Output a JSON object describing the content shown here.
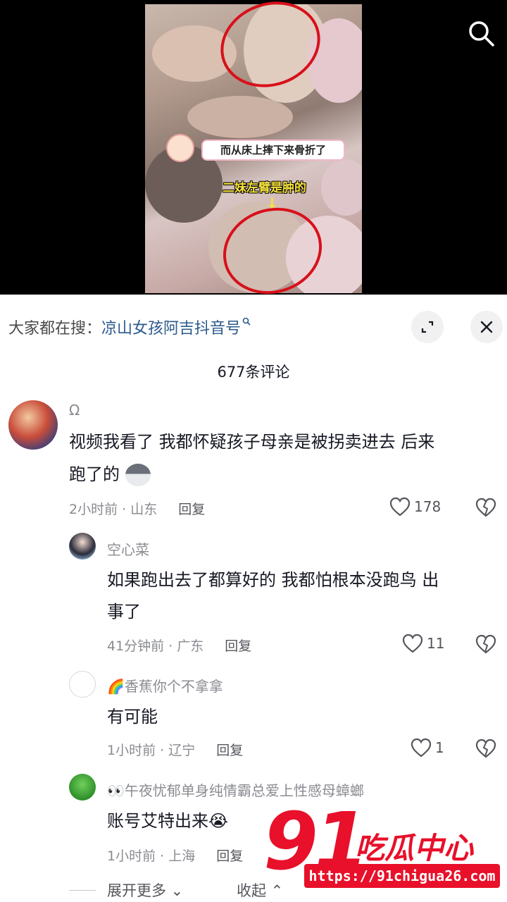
{
  "video": {
    "caption_1": "而从床上摔下来骨折了",
    "caption_2": "二妹左臂是肿的",
    "arrow": "↓"
  },
  "search_suggest": {
    "prefix": "大家都在搜：",
    "keyword": "凉山女孩阿吉抖音号"
  },
  "comments_header": {
    "count_text": "677条评论"
  },
  "comments": [
    {
      "username": "Ω",
      "text_line1": "视频我看了 我都怀疑孩子母亲是被拐卖进去 后来",
      "text_line2": "跑了的",
      "time_location": "2小时前 · 山东",
      "reply_label": "回复",
      "likes": "178"
    },
    {
      "username": "空心菜",
      "text_line1": "如果跑出去了都算好的 我都怕根本没跑鸟 出",
      "text_line2": "事了",
      "time_location": "41分钟前 · 广东",
      "reply_label": "回复",
      "likes": "11"
    },
    {
      "username": "🌈香蕉你个不拿拿",
      "text_line1": "有可能",
      "time_location": "1小时前 · 辽宁",
      "reply_label": "回复",
      "likes": "1"
    },
    {
      "username": "👀午夜忧郁单身纯情霸总爱上性感母蟑螂",
      "text_line1": "账号艾特出来😭",
      "time_location": "1小时前 · 上海",
      "reply_label": "回复"
    }
  ],
  "footer": {
    "expand_label": "展开更多",
    "collapse_label": "收起"
  },
  "watermark": {
    "number": "91",
    "brand": "吃瓜中心",
    "url": "https://91chigua26.com"
  },
  "colors": {
    "accent_keyword": "#2c5a8c",
    "muted_text": "#8a8b91",
    "watermark_red": "#e8102a",
    "annotation_red": "#d8101a"
  }
}
